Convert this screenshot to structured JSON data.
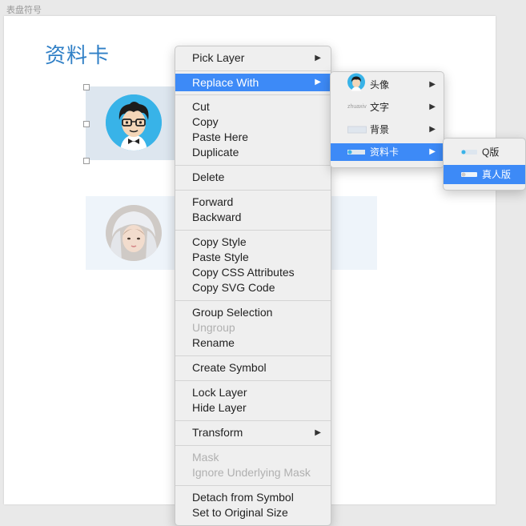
{
  "page": {
    "symbol_label": "表盘符号",
    "card_title": "资料卡"
  },
  "context_menu": {
    "pick_layer": "Pick Layer",
    "replace_with": "Replace With",
    "cut": "Cut",
    "copy": "Copy",
    "paste_here": "Paste Here",
    "duplicate": "Duplicate",
    "delete": "Delete",
    "forward": "Forward",
    "backward": "Backward",
    "copy_style": "Copy Style",
    "paste_style": "Paste Style",
    "copy_css": "Copy CSS Attributes",
    "copy_svg": "Copy SVG Code",
    "group_selection": "Group Selection",
    "ungroup": "Ungroup",
    "rename": "Rename",
    "create_symbol": "Create Symbol",
    "lock_layer": "Lock Layer",
    "hide_layer": "Hide Layer",
    "transform": "Transform",
    "mask": "Mask",
    "ignore_mask": "Ignore Underlying Mask",
    "detach": "Detach from Symbol",
    "original_size": "Set to Original Size",
    "submenu_arrow": "▶"
  },
  "replace_submenu": {
    "items": [
      "头像",
      "文字",
      "背景",
      "资料卡"
    ],
    "text_thumb": "zhuaxiv"
  },
  "profile_submenu": {
    "items": [
      "Q版",
      "真人版"
    ]
  },
  "colors": {
    "highlight": "#3d8af7",
    "title": "#2f7fc6"
  }
}
